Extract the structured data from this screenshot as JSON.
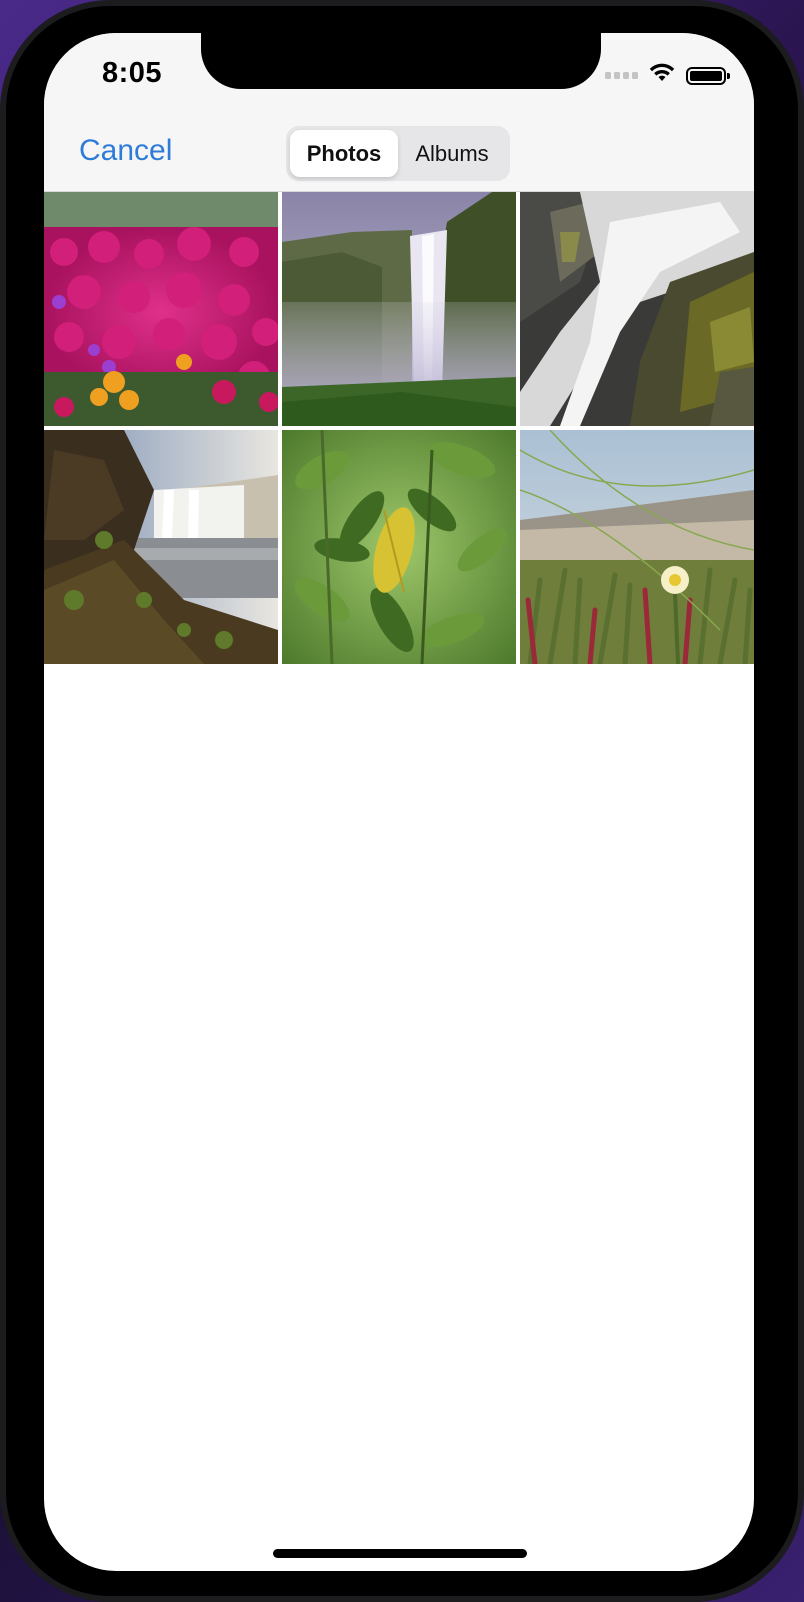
{
  "status_bar": {
    "time": "8:05",
    "icons": [
      "cellular-signal-icon",
      "wifi-icon",
      "battery-icon"
    ]
  },
  "nav": {
    "cancel_label": "Cancel",
    "segments": [
      {
        "label": "Photos",
        "selected": true
      },
      {
        "label": "Albums",
        "selected": false
      }
    ]
  },
  "photos": [
    {
      "subject": "magenta-flowers-photo"
    },
    {
      "subject": "waterfall-cliff-photo"
    },
    {
      "subject": "waterfall-rocks-photo"
    },
    {
      "subject": "waterfall-river-photo"
    },
    {
      "subject": "green-leaves-photo"
    },
    {
      "subject": "yellow-flower-photo"
    }
  ],
  "colors": {
    "accent": "#2f7cd8",
    "header_bg": "#f6f6f6",
    "segment_track": "#e6e6e8"
  }
}
